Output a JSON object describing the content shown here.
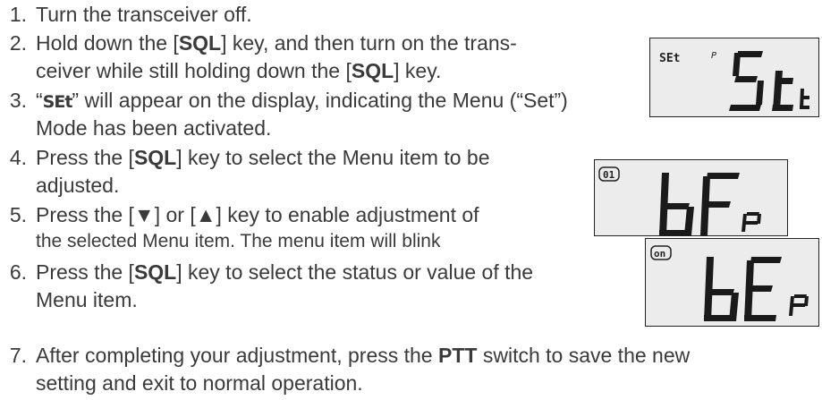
{
  "steps": [
    {
      "num": "1.",
      "text": "Turn the transceiver off."
    },
    {
      "num": "2.",
      "line1_a": "Hold down the [",
      "key": "SQL",
      "line1_b": "] key, and then turn on the trans-",
      "line2_a": "ceiver while still holding down the [",
      "line2_b": "] key."
    },
    {
      "num": "3.",
      "q_open": "“",
      "code": "SEt",
      "line1_b": "” will appear on the display, indicating the Menu (“Set”)",
      "line2": "Mode has been activated."
    },
    {
      "num": "4.",
      "line1_a": "Press the [",
      "key": "SQL",
      "line1_b": "] key to select the Menu item to be",
      "line2": "adjusted."
    },
    {
      "num": "5.",
      "line1": "Press the [▼] or [▲] key to enable adjustment of",
      "line2": "the selected Menu item. The menu item will blink"
    },
    {
      "num": "6.",
      "line1_a": "Press the [",
      "key": "SQL",
      "line1_b": "] key to select the status or value of the",
      "line2": "Menu item."
    },
    {
      "num": "7.",
      "line1_a": "After completing your adjustment, press the ",
      "ptt": "PTT",
      "line1_b": " switch to save the new",
      "line2": "setting and exit to normal operation."
    }
  ],
  "displays": [
    {
      "indicator": "SEt",
      "indicator2": "P",
      "main": "St",
      "sub": "t"
    },
    {
      "indicator": "01",
      "main": "bF",
      "sub": "P"
    },
    {
      "indicator": "on",
      "main": "bE",
      "sub": "P"
    }
  ]
}
